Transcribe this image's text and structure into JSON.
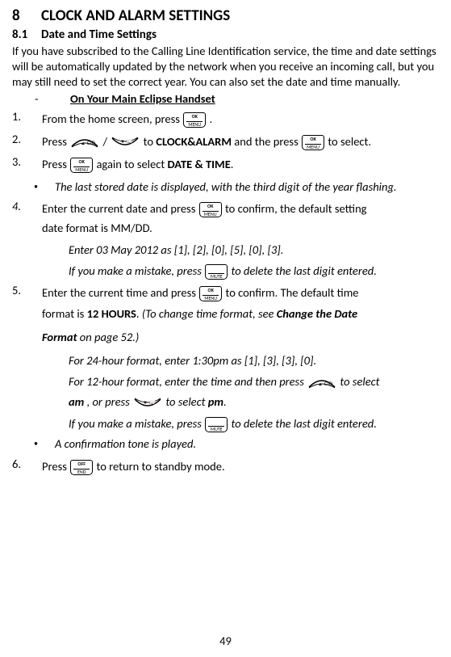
{
  "heading": {
    "num": "8",
    "title": "CLOCK AND ALARM SETTINGS"
  },
  "subheading": {
    "num": "8.1",
    "title": "Date and Time Settings"
  },
  "intro": "If you have subscribed to the Calling Line Identification service, the time and date settings will be automatically updated by the network when you receive an incoming call, but you may still need to set the correct year. You can also set the date and time manually.",
  "sub_bullet": "On Your Main Eclipse Handset",
  "steps": {
    "s1": {
      "n": "1.",
      "a": "From the home screen, press ",
      "b": " ."
    },
    "s2": {
      "n": "2.",
      "a": "Press ",
      "slash": " / ",
      "b": " to ",
      "c": "CLOCK&ALARM",
      "d": " and the press ",
      "e": "  to select."
    },
    "s3": {
      "n": "3.",
      "a": "Press ",
      "b": " again to select ",
      "c": "DATE & TIME",
      "d": "."
    },
    "s4": {
      "n": "4.",
      "a": "Enter the current date and press ",
      "b": "  to confirm, the default setting"
    },
    "s4c": "date format is MM/DD.",
    "s5": {
      "n": "5.",
      "a": "Enter the current time and press ",
      "b": "  to confirm. The default time"
    },
    "s5c1a": "format is ",
    "s5c1b": "12 HOURS",
    "s5c1c": ". ",
    "s5c1d": "(To change time format, see ",
    "s5c1e": "Change the Date",
    "s5c2a": "Format",
    "s5c2b": " on page 52.)",
    "s6": {
      "n": "6.",
      "a": "Press ",
      "b": "  to return to standby mode."
    }
  },
  "notes": {
    "n1": "The last stored date is displayed, with the third digit of the year flashing.",
    "n2": "A confirmation tone is played."
  },
  "substeps": {
    "a1": "Enter 03 May 2012 as [1], [2], [0], [5], [0], [3].",
    "a2a": "If you make a mistake, press ",
    "a2b": " to delete the last digit entered.",
    "b1": "For 24-hour format, enter 1:30pm as [1], [3], [3], [0].",
    "b2a": "For 12-hour format, enter the time and then press  ",
    "b2b": "  to select",
    "b3a": "am",
    "b3b": " , or press ",
    "b3c": " to select ",
    "b3d": "pm",
    "b3e": ".",
    "b4a": "If you make a mistake, press ",
    "b4b": " to delete the last digit entered."
  },
  "keys": {
    "ok_menu": {
      "l1": "OK",
      "l2": "MENU"
    },
    "mute": {
      "l1": "",
      "l2": "MUTE"
    },
    "off_end": {
      "l1": "OFF",
      "l2": "END"
    }
  },
  "page": "49"
}
